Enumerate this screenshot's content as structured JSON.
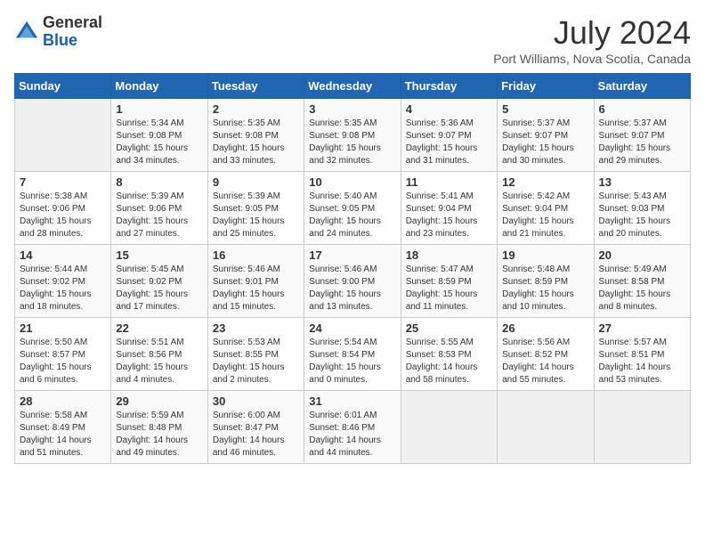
{
  "header": {
    "logo_line1": "General",
    "logo_line2": "Blue",
    "month_title": "July 2024",
    "location": "Port Williams, Nova Scotia, Canada"
  },
  "days_of_week": [
    "Sunday",
    "Monday",
    "Tuesday",
    "Wednesday",
    "Thursday",
    "Friday",
    "Saturday"
  ],
  "weeks": [
    [
      {
        "day": "",
        "info": ""
      },
      {
        "day": "1",
        "info": "Sunrise: 5:34 AM\nSunset: 9:08 PM\nDaylight: 15 hours\nand 34 minutes."
      },
      {
        "day": "2",
        "info": "Sunrise: 5:35 AM\nSunset: 9:08 PM\nDaylight: 15 hours\nand 33 minutes."
      },
      {
        "day": "3",
        "info": "Sunrise: 5:35 AM\nSunset: 9:08 PM\nDaylight: 15 hours\nand 32 minutes."
      },
      {
        "day": "4",
        "info": "Sunrise: 5:36 AM\nSunset: 9:07 PM\nDaylight: 15 hours\nand 31 minutes."
      },
      {
        "day": "5",
        "info": "Sunrise: 5:37 AM\nSunset: 9:07 PM\nDaylight: 15 hours\nand 30 minutes."
      },
      {
        "day": "6",
        "info": "Sunrise: 5:37 AM\nSunset: 9:07 PM\nDaylight: 15 hours\nand 29 minutes."
      }
    ],
    [
      {
        "day": "7",
        "info": "Sunrise: 5:38 AM\nSunset: 9:06 PM\nDaylight: 15 hours\nand 28 minutes."
      },
      {
        "day": "8",
        "info": "Sunrise: 5:39 AM\nSunset: 9:06 PM\nDaylight: 15 hours\nand 27 minutes."
      },
      {
        "day": "9",
        "info": "Sunrise: 5:39 AM\nSunset: 9:05 PM\nDaylight: 15 hours\nand 25 minutes."
      },
      {
        "day": "10",
        "info": "Sunrise: 5:40 AM\nSunset: 9:05 PM\nDaylight: 15 hours\nand 24 minutes."
      },
      {
        "day": "11",
        "info": "Sunrise: 5:41 AM\nSunset: 9:04 PM\nDaylight: 15 hours\nand 23 minutes."
      },
      {
        "day": "12",
        "info": "Sunrise: 5:42 AM\nSunset: 9:04 PM\nDaylight: 15 hours\nand 21 minutes."
      },
      {
        "day": "13",
        "info": "Sunrise: 5:43 AM\nSunset: 9:03 PM\nDaylight: 15 hours\nand 20 minutes."
      }
    ],
    [
      {
        "day": "14",
        "info": "Sunrise: 5:44 AM\nSunset: 9:02 PM\nDaylight: 15 hours\nand 18 minutes."
      },
      {
        "day": "15",
        "info": "Sunrise: 5:45 AM\nSunset: 9:02 PM\nDaylight: 15 hours\nand 17 minutes."
      },
      {
        "day": "16",
        "info": "Sunrise: 5:46 AM\nSunset: 9:01 PM\nDaylight: 15 hours\nand 15 minutes."
      },
      {
        "day": "17",
        "info": "Sunrise: 5:46 AM\nSunset: 9:00 PM\nDaylight: 15 hours\nand 13 minutes."
      },
      {
        "day": "18",
        "info": "Sunrise: 5:47 AM\nSunset: 8:59 PM\nDaylight: 15 hours\nand 11 minutes."
      },
      {
        "day": "19",
        "info": "Sunrise: 5:48 AM\nSunset: 8:59 PM\nDaylight: 15 hours\nand 10 minutes."
      },
      {
        "day": "20",
        "info": "Sunrise: 5:49 AM\nSunset: 8:58 PM\nDaylight: 15 hours\nand 8 minutes."
      }
    ],
    [
      {
        "day": "21",
        "info": "Sunrise: 5:50 AM\nSunset: 8:57 PM\nDaylight: 15 hours\nand 6 minutes."
      },
      {
        "day": "22",
        "info": "Sunrise: 5:51 AM\nSunset: 8:56 PM\nDaylight: 15 hours\nand 4 minutes."
      },
      {
        "day": "23",
        "info": "Sunrise: 5:53 AM\nSunset: 8:55 PM\nDaylight: 15 hours\nand 2 minutes."
      },
      {
        "day": "24",
        "info": "Sunrise: 5:54 AM\nSunset: 8:54 PM\nDaylight: 15 hours\nand 0 minutes."
      },
      {
        "day": "25",
        "info": "Sunrise: 5:55 AM\nSunset: 8:53 PM\nDaylight: 14 hours\nand 58 minutes."
      },
      {
        "day": "26",
        "info": "Sunrise: 5:56 AM\nSunset: 8:52 PM\nDaylight: 14 hours\nand 55 minutes."
      },
      {
        "day": "27",
        "info": "Sunrise: 5:57 AM\nSunset: 8:51 PM\nDaylight: 14 hours\nand 53 minutes."
      }
    ],
    [
      {
        "day": "28",
        "info": "Sunrise: 5:58 AM\nSunset: 8:49 PM\nDaylight: 14 hours\nand 51 minutes."
      },
      {
        "day": "29",
        "info": "Sunrise: 5:59 AM\nSunset: 8:48 PM\nDaylight: 14 hours\nand 49 minutes."
      },
      {
        "day": "30",
        "info": "Sunrise: 6:00 AM\nSunset: 8:47 PM\nDaylight: 14 hours\nand 46 minutes."
      },
      {
        "day": "31",
        "info": "Sunrise: 6:01 AM\nSunset: 8:46 PM\nDaylight: 14 hours\nand 44 minutes."
      },
      {
        "day": "",
        "info": ""
      },
      {
        "day": "",
        "info": ""
      },
      {
        "day": "",
        "info": ""
      }
    ]
  ]
}
